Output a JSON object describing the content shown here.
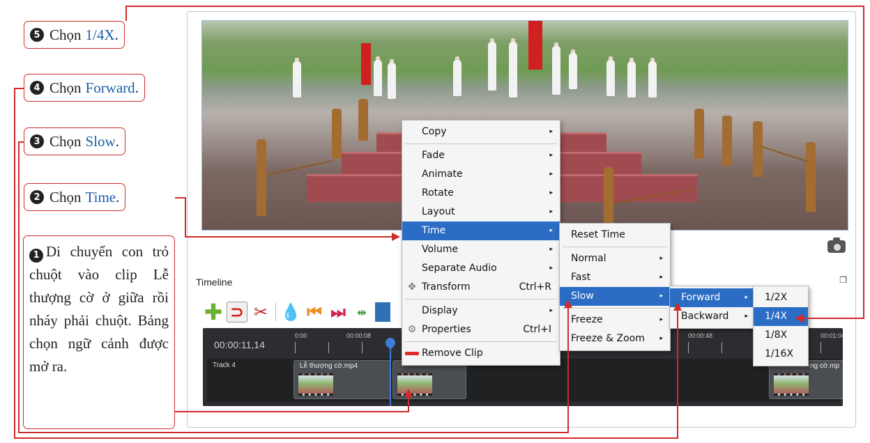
{
  "callouts": {
    "step5": {
      "num": "5",
      "text": "Chọn",
      "highlight": "1/4X",
      "end": "."
    },
    "step4": {
      "num": "4",
      "text": "Chọn",
      "highlight": "Forward",
      "end": "."
    },
    "step3": {
      "num": "3",
      "text": "Chọn",
      "highlight": "Slow",
      "end": "."
    },
    "step2": {
      "num": "2",
      "text": "Chọn",
      "highlight": "Time",
      "end": "."
    },
    "step1": {
      "num": "1",
      "text": "Di chuyển con trỏ chuột vào clip Lễ thượng cờ ở giữa rồi nháy phải chuột. Bảng chọn ngữ cảnh được mở ra."
    }
  },
  "app": {
    "timeline_label": "Timeline",
    "timecode": "00:00:11,14",
    "ruler": [
      "0:00",
      "00:00:08",
      "00:00:48",
      "00:01:04"
    ],
    "track_name": "Track 4",
    "clips": [
      {
        "title": "Lễ thượng cờ.mp4"
      },
      {
        "title": ""
      },
      {
        "title": "ng cờ.mp"
      }
    ]
  },
  "context_menu": {
    "items": [
      {
        "label": "Copy",
        "submenu": true
      },
      {
        "label": "Fade",
        "submenu": true
      },
      {
        "label": "Animate",
        "submenu": true
      },
      {
        "label": "Rotate",
        "submenu": true
      },
      {
        "label": "Layout",
        "submenu": true
      },
      {
        "label": "Time",
        "submenu": true,
        "active": true
      },
      {
        "label": "Volume",
        "submenu": true
      },
      {
        "label": "Separate Audio",
        "submenu": true
      },
      {
        "label": "Transform",
        "shortcut": "Ctrl+R"
      },
      {
        "label": "Display",
        "submenu": true
      },
      {
        "label": "Properties",
        "shortcut": "Ctrl+I"
      },
      {
        "label": "Remove Clip"
      }
    ]
  },
  "time_menu": {
    "items": [
      {
        "label": "Reset Time"
      },
      {
        "label": "Normal",
        "submenu": true
      },
      {
        "label": "Fast",
        "submenu": true
      },
      {
        "label": "Slow",
        "submenu": true,
        "active": true
      },
      {
        "label": "Freeze",
        "submenu": true
      },
      {
        "label": "Freeze & Zoom",
        "submenu": true
      }
    ]
  },
  "slow_menu": {
    "items": [
      {
        "label": "Forward",
        "submenu": true,
        "active": true
      },
      {
        "label": "Backward",
        "submenu": true
      }
    ]
  },
  "speed_menu": {
    "items": [
      {
        "label": "1/2X"
      },
      {
        "label": "1/4X",
        "active": true
      },
      {
        "label": "1/8X"
      },
      {
        "label": "1/16X"
      }
    ]
  },
  "colors": {
    "accent": "#2b6cc4",
    "callout_border": "#d12a2a",
    "highlight_text": "#1a5fa8"
  },
  "icons": {
    "submenu_arrow": "▸",
    "transform": "✥",
    "properties": "⚙",
    "add": "✚",
    "magnet": "⊃",
    "cut": "✂",
    "marker": "💧",
    "prev": "⏮",
    "next": "⏭",
    "center": "⇹"
  }
}
